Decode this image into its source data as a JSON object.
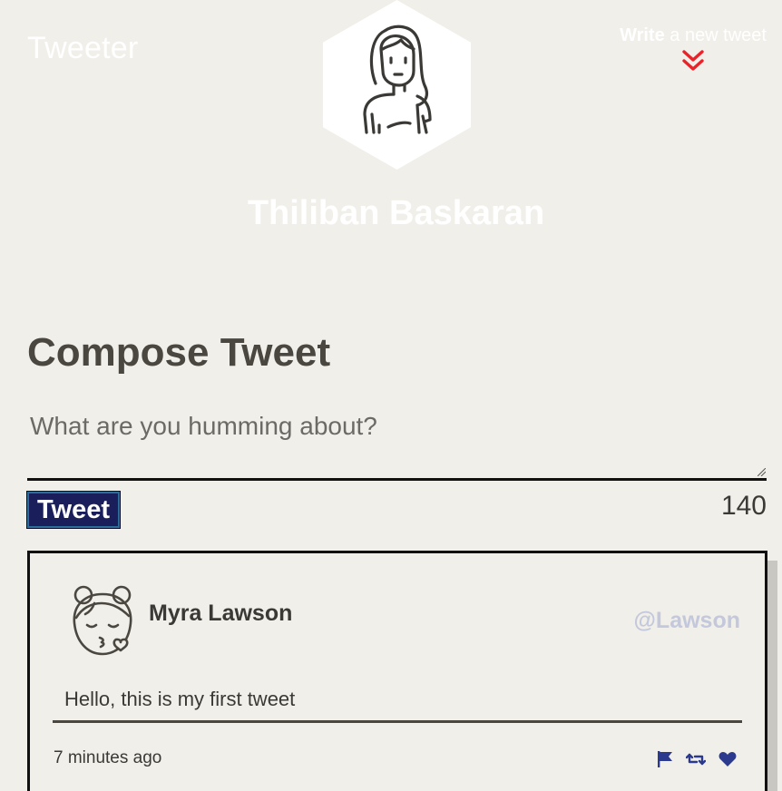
{
  "header": {
    "brand": "Tweeter",
    "write_bold": "Write",
    "write_rest": " a new tweet",
    "chevron_icon": "double-chevron-down-icon",
    "accent_color": "#e8232a"
  },
  "profile": {
    "name": "Thiliban Baskaran",
    "avatar_icon": "girl-avatar-icon"
  },
  "compose": {
    "title": "Compose Tweet",
    "placeholder": "What are you humming about?",
    "value": "",
    "button_label": "Tweet",
    "counter": "140"
  },
  "tweets": [
    {
      "author": "Myra Lawson",
      "handle": "@Lawson",
      "text": "Hello, this is my first tweet",
      "time": "7 minutes ago",
      "avatar_icon": "kissing-girl-avatar-icon",
      "actions": [
        "flag-icon",
        "retweet-icon",
        "heart-icon"
      ],
      "action_color": "#2b3a8c"
    }
  ]
}
